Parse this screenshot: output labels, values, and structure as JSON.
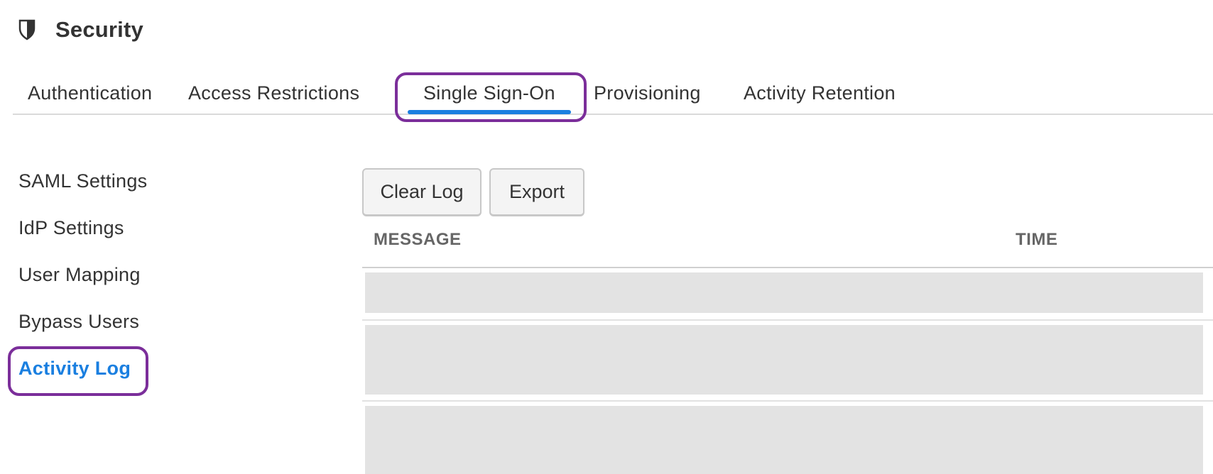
{
  "header": {
    "icon": "shield-icon",
    "title": "Security"
  },
  "tabs": [
    {
      "label": "Authentication",
      "active": false
    },
    {
      "label": "Access Restrictions",
      "active": false
    },
    {
      "label": "Single Sign-On",
      "active": true
    },
    {
      "label": "Provisioning",
      "active": false
    },
    {
      "label": "Activity Retention",
      "active": false
    }
  ],
  "sidebar": {
    "items": [
      {
        "label": "SAML Settings",
        "active": false
      },
      {
        "label": "IdP Settings",
        "active": false
      },
      {
        "label": "User Mapping",
        "active": false
      },
      {
        "label": "Bypass Users",
        "active": false
      },
      {
        "label": "Activity Log",
        "active": true
      }
    ]
  },
  "toolbar": {
    "clear_label": "Clear Log",
    "export_label": "Export"
  },
  "table": {
    "columns": [
      "MESSAGE",
      "TIME"
    ],
    "rows": []
  },
  "colors": {
    "accent": "#1a7fe0",
    "highlight": "#7b2e9a",
    "placeholder": "#e3e3e3"
  }
}
